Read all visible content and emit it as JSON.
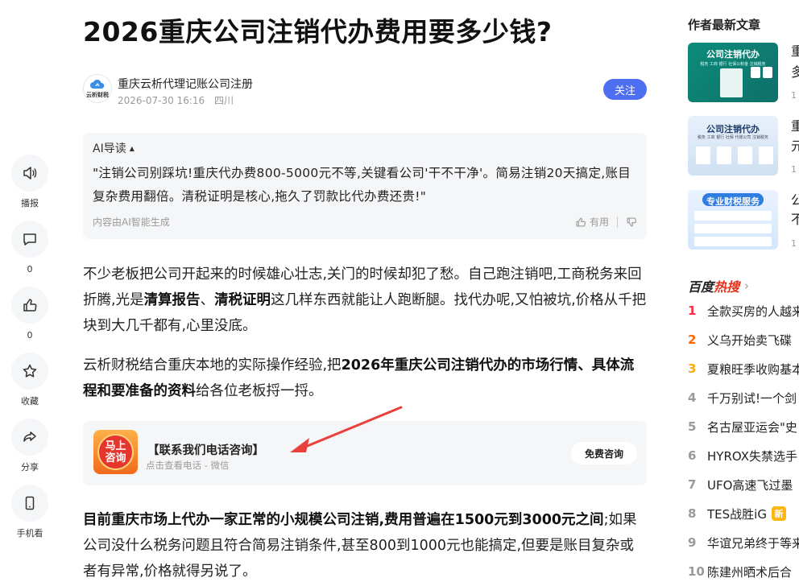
{
  "article": {
    "title": "2026重庆公司注销代办费用要多少钱?",
    "author": {
      "name": "重庆云析代理记账公司注册",
      "avatar_text": "云析财税",
      "date": "2026-07-30 16:16",
      "location": "四川",
      "follow_label": "关注"
    },
    "ai_summary": {
      "header": "AI导读",
      "text": "\"注销公司别踩坑!重庆代办费800-5000元不等,关键看公司'干不干净'。简易注销20天搞定,账目复杂费用翻倍。清税证明是核心,拖久了罚款比代办费还贵!\"",
      "footer_note": "内容由AI智能生成",
      "useful_label": "有用"
    },
    "paragraph1": {
      "a": "不少老板把公司开起来的时候雄心壮志,关门的时候却犯了愁。自己跑注销吧,工商税务来回折腾,光是",
      "b": "清算报告",
      "c": "、",
      "d": "清税证明",
      "e": "这几样东西就能让人跑断腿。找代办呢,又怕被坑,价格从千把块到大几千都有,心里没底。"
    },
    "paragraph2": {
      "a": "云析财税结合重庆本地的实际操作经验,把",
      "b": "2026年重庆公司注销代办的市场行情、具体流程和要准备的资料",
      "c": "给各位老板捋一捋。"
    },
    "consult": {
      "icon_text": "马上咨询",
      "title": "【联系我们电话咨询】",
      "subtitle": "点击查看电话 - 微信",
      "button": "免费咨询"
    },
    "paragraph3": {
      "a": "目前重庆市场上代办一家正常的小规模公司注销,费用普遍在1500元到3000元之间",
      "b": ";如果公司没什么税务问题且符合简易注销条件,甚至800到1000元也能搞定,但要是账目复杂或者有异常,价格就得另说了。"
    }
  },
  "left_rail": [
    {
      "label": "播报",
      "icon": "speaker-icon"
    },
    {
      "label": "0",
      "icon": "comment-icon"
    },
    {
      "label": "0",
      "icon": "thumbs-up-icon"
    },
    {
      "label": "收藏",
      "icon": "star-icon"
    },
    {
      "label": "分享",
      "icon": "share-icon"
    },
    {
      "label": "手机看",
      "icon": "phone-icon"
    }
  ],
  "sidebar": {
    "latest_title": "作者最新文章",
    "latest": [
      {
        "thumb_label": "公司注销代办",
        "thumb_sub": "税务 工商 银行 社保公积金 注销税务",
        "title_frag_1": "重",
        "title_frag_2": "多",
        "meta_frag": "1"
      },
      {
        "thumb_label": "公司注销代办",
        "thumb_sub": "税务 工商 银行 社保 代账公司 注销税务",
        "title_frag_1": "重",
        "title_frag_2": "元",
        "meta_frag": "1"
      },
      {
        "thumb_label": "专业财税服务",
        "thumb_sub": "",
        "title_frag_1": "公",
        "title_frag_2": "不",
        "meta_frag": "1"
      }
    ],
    "hot": {
      "brand_a": "百度",
      "brand_b": "热搜",
      "items": [
        {
          "rank": "1",
          "text": "全款买房的人越来"
        },
        {
          "rank": "2",
          "text": "义乌开始卖飞碟"
        },
        {
          "rank": "3",
          "text": "夏粮旺季收购基本"
        },
        {
          "rank": "4",
          "text": "千万别试!一个剑"
        },
        {
          "rank": "5",
          "text": "名古屋亚运会\"史"
        },
        {
          "rank": "6",
          "text": "HYROX失禁选手"
        },
        {
          "rank": "7",
          "text": "UFO高速飞过墨"
        },
        {
          "rank": "8",
          "text": "TES战胜iG",
          "badge": "新"
        },
        {
          "rank": "9",
          "text": "华谊兄弟终于等来"
        },
        {
          "rank": "10",
          "text": "陈建州晒术后合"
        }
      ]
    }
  },
  "colors": {
    "accent": "#4e6ef2",
    "hot_red": "#fe2d46",
    "hot_orange": "#ff6600",
    "hot_yellow": "#faa90e",
    "arrow_red": "#e8403a"
  }
}
